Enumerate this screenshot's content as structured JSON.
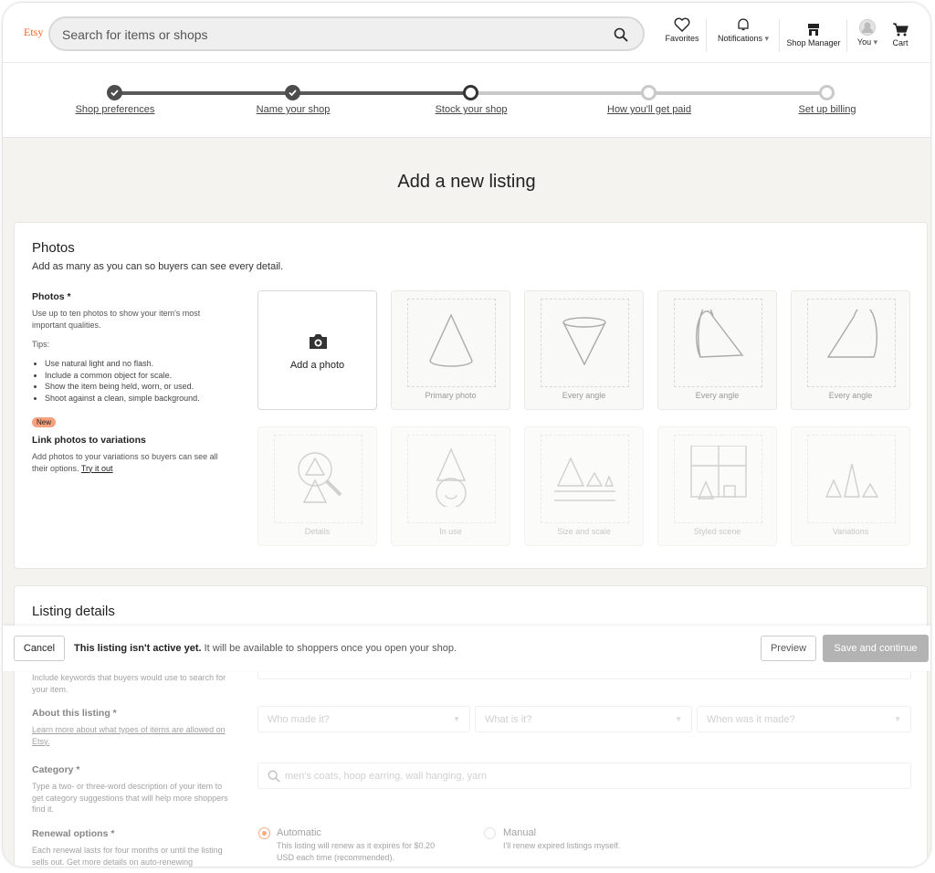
{
  "header": {
    "logo": "Etsy",
    "search_placeholder": "Search for items or shops",
    "nav": [
      "Favorites",
      "Notifications",
      "Shop Manager",
      "You",
      "Cart"
    ]
  },
  "progress": {
    "steps": [
      {
        "label": "Shop preferences",
        "state": "done"
      },
      {
        "label": "Name your shop",
        "state": "done"
      },
      {
        "label": "Stock your shop",
        "state": "current"
      },
      {
        "label": "How you'll get paid",
        "state": "todo"
      },
      {
        "label": "Set up billing",
        "state": "todo"
      }
    ]
  },
  "page_title": "Add a new listing",
  "photos": {
    "title": "Photos",
    "subtitle": "Add as many as you can so buyers can see every detail.",
    "field_label": "Photos *",
    "field_desc": "Use up to ten photos to show your item's most important qualities.",
    "tips_label": "Tips:",
    "tips": [
      "Use natural light and no flash.",
      "Include a common object for scale.",
      "Show the item being held, worn, or used.",
      "Shoot against a clean, simple background."
    ],
    "badge": "New",
    "link_title": "Link photos to variations",
    "link_desc": "Add photos to your variations so buyers can see all their options.",
    "link_cta": "Try it out",
    "add_photo": "Add a photo",
    "tiles": [
      "Primary photo",
      "Every angle",
      "Every angle",
      "Every angle",
      "Details",
      "In use",
      "Size and scale",
      "Styled scene",
      "Variations"
    ]
  },
  "details": {
    "title": "Listing details",
    "keywords_hint": "Include keywords that buyers would use to search for your item.",
    "about_label": "About this listing *",
    "about_link": "Learn more about what types of items are allowed on Etsy.",
    "selects": [
      "Who made it?",
      "What is it?",
      "When was it made?"
    ],
    "category_label": "Category *",
    "category_desc": "Type a two- or three-word description of your item to get category suggestions that will help more shoppers find it.",
    "category_placeholder": "men's coats, hoop earring, wall hanging, yarn",
    "renewal_label": "Renewal options *",
    "renewal_desc": "Each renewal lasts for four months or until the listing sells out. Get more details on auto-renewing",
    "opt_auto": "Automatic",
    "opt_auto_desc": "This listing will renew as it expires for $0.20 USD each time (recommended).",
    "opt_manual": "Manual",
    "opt_manual_desc": "I'll renew expired listings myself."
  },
  "bottom_bar": {
    "cancel": "Cancel",
    "notice_bold": "This listing isn't active yet.",
    "notice": " It will be available to shoppers once you open your shop.",
    "preview": "Preview",
    "save": "Save and continue"
  },
  "colors": {
    "accent": "#f1641e",
    "progress_done": "#595959",
    "progress_todo": "#c9c9c9",
    "save_disabled": "#b3b3b3"
  }
}
